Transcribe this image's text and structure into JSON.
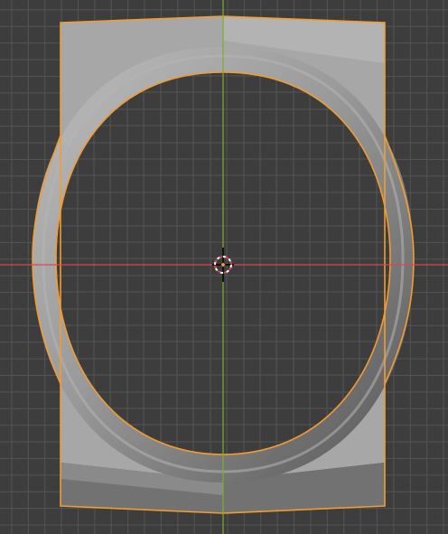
{
  "viewport": {
    "background_color": "#3d3d3d",
    "grid_color": "#555555",
    "x_axis_color": "#d44a55",
    "y_axis_color": "#7bb02b"
  },
  "selection": {
    "outline_color": "#f29c32",
    "selected_object": "frame-with-oval-cutout"
  },
  "object": {
    "light_face_color": "#a6a6a6",
    "mid_face_color": "#8f8f8f",
    "dark_face_color": "#707070",
    "ring_color": "#8c8c8c"
  },
  "icons": {
    "origin": "object-origin-dot-icon",
    "cursor": "3d-cursor-icon"
  }
}
